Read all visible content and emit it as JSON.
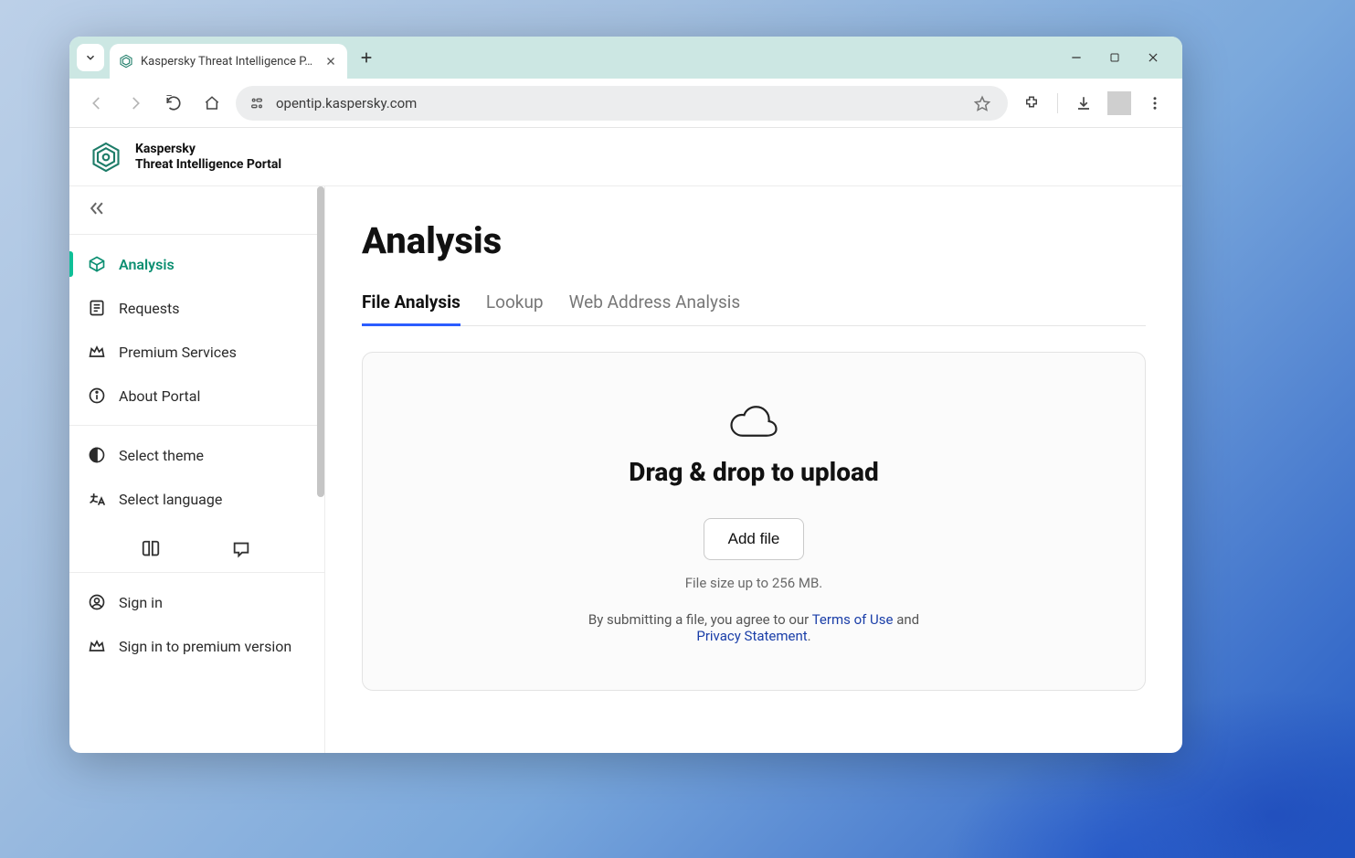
{
  "browser": {
    "tab_title": "Kaspersky Threat Intelligence P…",
    "url": "opentip.kaspersky.com"
  },
  "header": {
    "brand_line1": "Kaspersky",
    "brand_line2": "Threat Intelligence Portal"
  },
  "sidebar": {
    "items": [
      {
        "label": "Analysis"
      },
      {
        "label": "Requests"
      },
      {
        "label": "Premium Services"
      },
      {
        "label": "About Portal"
      }
    ],
    "secondary": [
      {
        "label": "Select theme"
      },
      {
        "label": "Select language"
      }
    ],
    "auth": [
      {
        "label": "Sign in"
      },
      {
        "label": "Sign in to premium version"
      }
    ]
  },
  "main": {
    "title": "Analysis",
    "tabs": [
      {
        "label": "File Analysis"
      },
      {
        "label": "Lookup"
      },
      {
        "label": "Web Address Analysis"
      }
    ],
    "dropzone": {
      "title": "Drag & drop to upload",
      "button": "Add file",
      "limit": "File size up to 256 MB.",
      "disclaimer_prefix": "By submitting a file, you agree to our ",
      "terms": "Terms of Use",
      "and": " and ",
      "privacy": "Privacy Statement",
      "period": "."
    }
  }
}
